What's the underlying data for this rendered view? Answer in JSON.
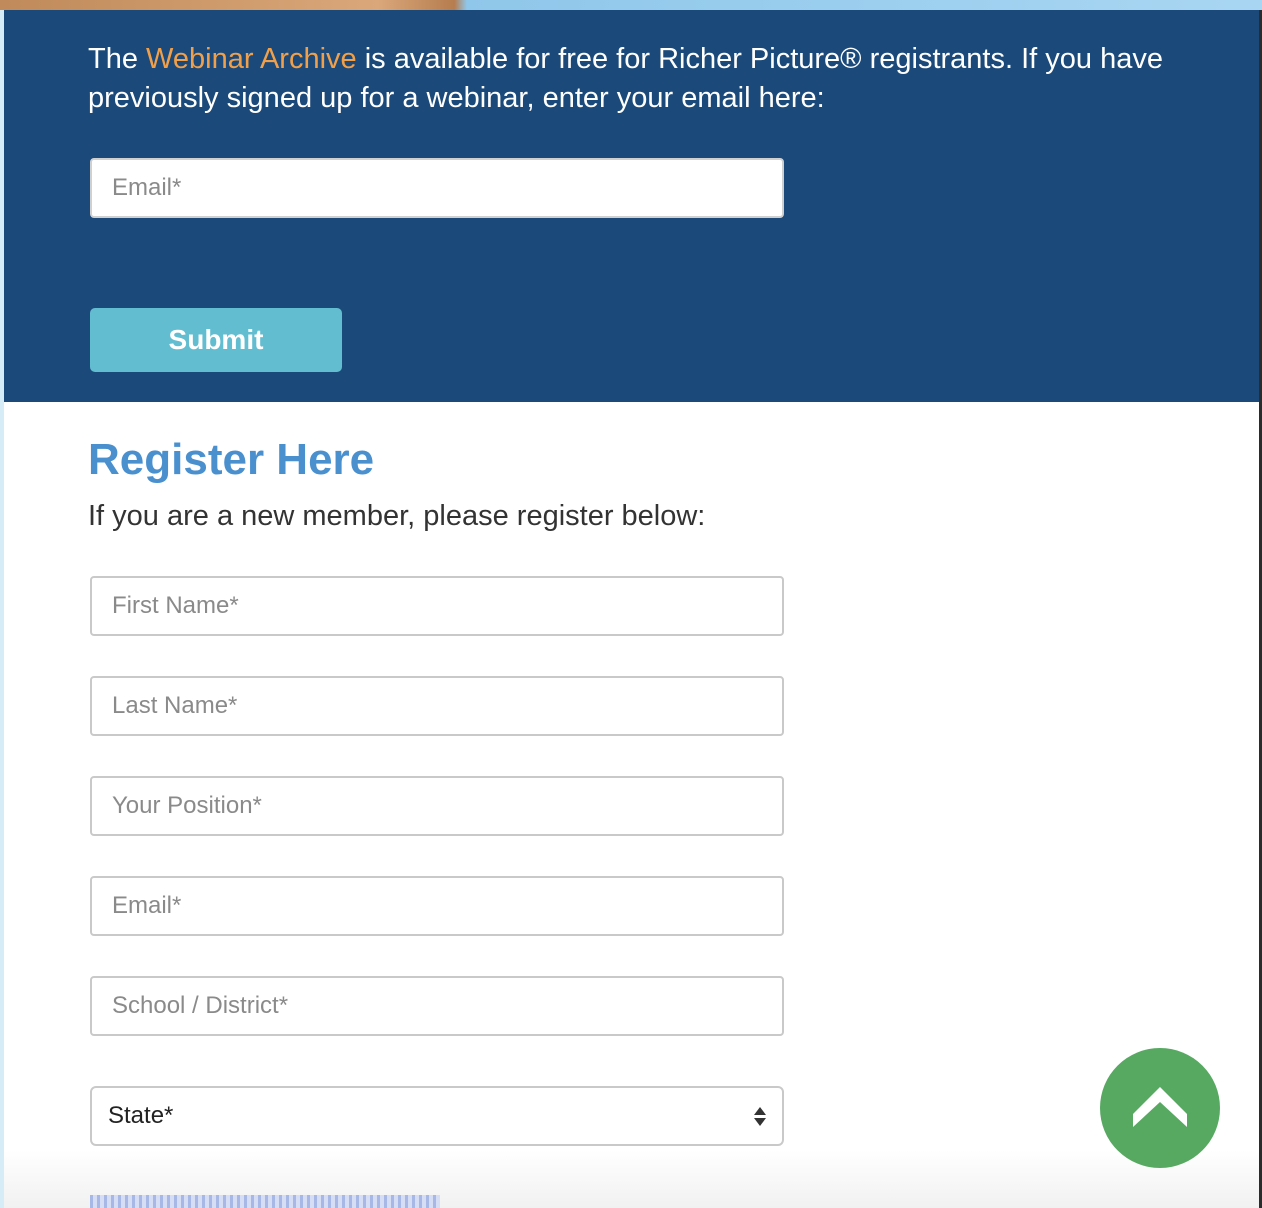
{
  "archive": {
    "text_before": "The ",
    "link_label": "Webinar Archive",
    "text_after": " is available for free for Richer Picture® registrants. If you have previously signed up for a webinar, enter your email here:",
    "email_placeholder": "Email*",
    "submit_label": "Submit"
  },
  "register": {
    "title": "Register Here",
    "subtitle": "If you are a new member, please register below:",
    "fields": {
      "first_name_placeholder": "First Name*",
      "last_name_placeholder": "Last Name*",
      "position_placeholder": "Your Position*",
      "email_placeholder": "Email*",
      "school_placeholder": "School / District*"
    },
    "state_select": {
      "selected": "State*"
    }
  },
  "colors": {
    "panel_bg": "#1b4a7a",
    "link": "#f0a04b",
    "submit_bg": "#63bdd1",
    "title": "#4a90cf",
    "scroll_top_bg": "#57a962"
  },
  "icons": {
    "scroll_top": "chevron-up-icon",
    "select_arrows": "up-down-arrows-icon"
  }
}
